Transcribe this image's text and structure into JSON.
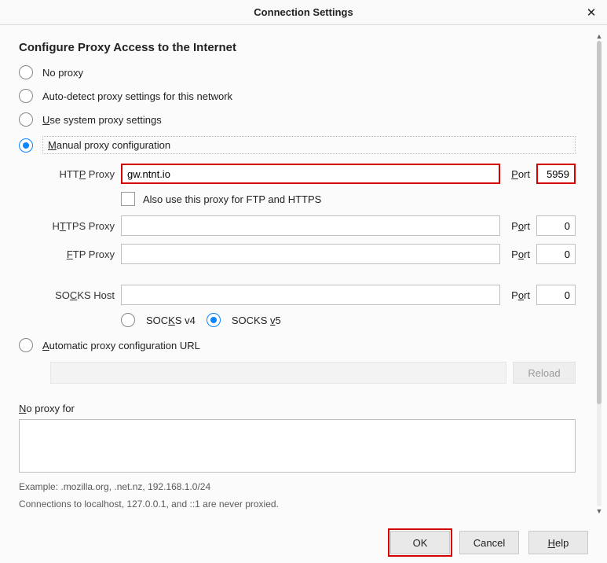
{
  "title": "Connection Settings",
  "heading": "Configure Proxy Access to the Internet",
  "options": {
    "no_proxy": "No proxy",
    "auto_detect": "Auto-detect proxy settings for this network",
    "system": "Use system proxy settings",
    "manual": "Manual proxy configuration",
    "pac": "Automatic proxy configuration URL"
  },
  "fields": {
    "http_label": "HTTP Proxy",
    "http_value": "gw.ntnt.io",
    "http_port": "5959",
    "https_label": "HTTPS Proxy",
    "https_value": "",
    "https_port": "0",
    "ftp_label": "FTP Proxy",
    "ftp_value": "",
    "ftp_port": "0",
    "socks_label": "SOCKS Host",
    "socks_value": "",
    "socks_port": "0",
    "port_label": "Port"
  },
  "also_use": "Also use this proxy for FTP and HTTPS",
  "socks": {
    "v4": "SOCKS v4",
    "v5": "SOCKS v5"
  },
  "reload": "Reload",
  "noproxy_label": "No proxy for",
  "example": "Example: .mozilla.org, .net.nz, 192.168.1.0/24",
  "localhost_note": "Connections to localhost, 127.0.0.1, and ::1 are never proxied.",
  "buttons": {
    "ok": "OK",
    "cancel": "Cancel",
    "help": "Help"
  }
}
